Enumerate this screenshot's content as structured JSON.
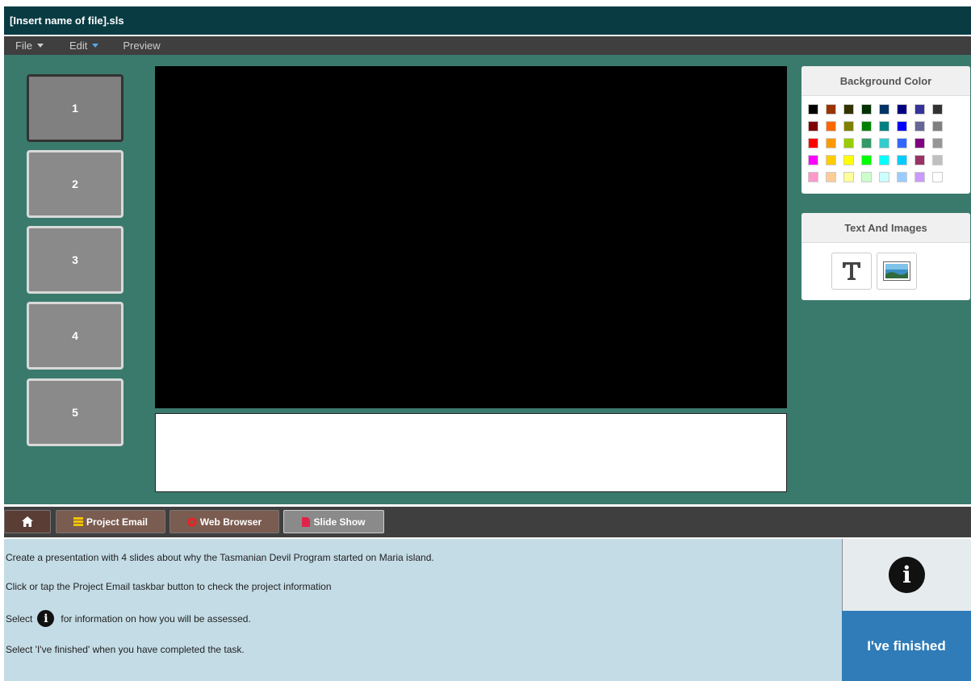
{
  "window": {
    "title": "[Insert name of file].sls"
  },
  "menu": {
    "file": "File",
    "edit": "Edit",
    "preview": "Preview"
  },
  "slides": [
    {
      "label": "1",
      "selected": true
    },
    {
      "label": "2"
    },
    {
      "label": "3"
    },
    {
      "label": "4"
    },
    {
      "label": "5"
    }
  ],
  "background_panel": {
    "title": "Background Color",
    "colors": [
      "#000000",
      "#993300",
      "#333300",
      "#003300",
      "#003366",
      "#000080",
      "#333399",
      "#333333",
      "#800000",
      "#ff6600",
      "#808000",
      "#008000",
      "#008080",
      "#0000ff",
      "#666699",
      "#808080",
      "#ff0000",
      "#ff9900",
      "#99cc00",
      "#339966",
      "#33cccc",
      "#3366ff",
      "#800080",
      "#969696",
      "#ff00ff",
      "#ffcc00",
      "#ffff00",
      "#00ff00",
      "#00ffff",
      "#00ccff",
      "#993366",
      "#c0c0c0",
      "#ff99cc",
      "#ffcc99",
      "#ffff99",
      "#ccffcc",
      "#ccffff",
      "#99ccff",
      "#cc99ff",
      "#ffffff"
    ]
  },
  "text_images_panel": {
    "title": "Text And Images",
    "text_tool_icon": "text-T-icon",
    "image_tool_icon": "landscape-image-icon"
  },
  "taskbar": {
    "home_icon": "home-icon",
    "project_email": "Project Email",
    "web_browser": "Web Browser",
    "slide_show": "Slide Show"
  },
  "instructions": {
    "line1": "Create a presentation with 4 slides about why the Tasmanian Devil Program started on Maria island.",
    "line2": "Click or tap the Project Email taskbar button to check the project information",
    "line3_pre": "Select",
    "line3_post": "for information on how you will be assessed.",
    "line4": "Select 'I've finished' when you have completed the task."
  },
  "finished_button": "I've finished",
  "colors": {
    "titlebar": "#093b43",
    "workspace": "#3a7a6d",
    "finished": "#2f7cb9",
    "instructions_bg": "#c4dce6"
  }
}
